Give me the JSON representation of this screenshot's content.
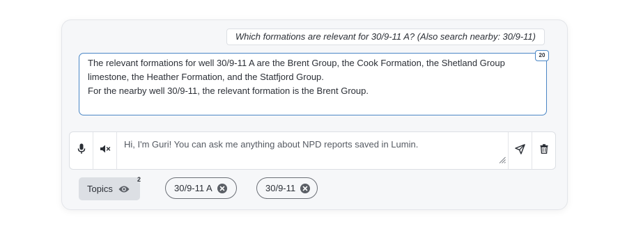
{
  "question": "Which formations are relevant for 30/9-11 A? (Also search nearby: 30/9-11)",
  "answer": {
    "lines": [
      "The relevant formations for well 30/9-11 A are the Brent Group, the Cook Formation, the Shetland Group limestone, the Heather Formation, and the Statfjord Group.",
      "For the nearby well 30/9-11, the relevant formation is the Brent Group."
    ],
    "count": "20"
  },
  "input": {
    "placeholder": "Hi, I'm Guri! You can ask me anything about NPD reports saved in Lumin.",
    "value": ""
  },
  "icons": {
    "mic": "microphone-icon",
    "mute": "speaker-muted-icon",
    "send": "send-icon",
    "delete": "trash-icon",
    "topics": "eye-icon",
    "chip_remove": "close-circle-icon"
  },
  "topics": {
    "label": "Topics",
    "count": "2",
    "chips": [
      {
        "label": "30/9-11 A"
      },
      {
        "label": "30/9-11"
      }
    ]
  },
  "colors": {
    "accent": "#4a86c5",
    "card_bg": "#f6f7f9",
    "topics_bg": "#dcdfe4"
  }
}
